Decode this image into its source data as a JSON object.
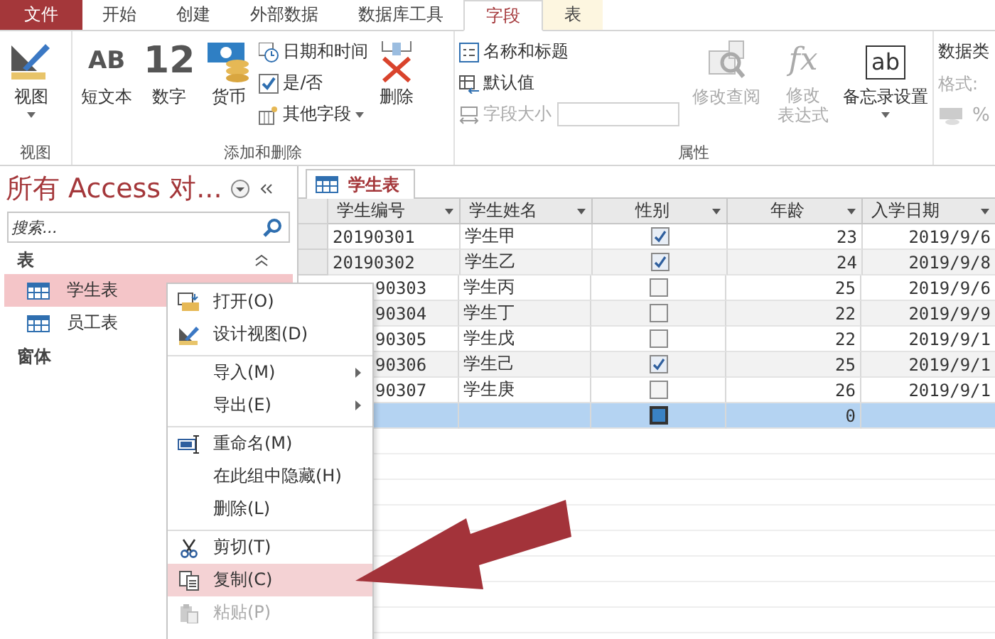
{
  "tabs": [
    {
      "label": "文件",
      "kind": "file",
      "selected": false
    },
    {
      "label": "开始",
      "kind": "normal",
      "selected": false
    },
    {
      "label": "创建",
      "kind": "normal",
      "selected": false
    },
    {
      "label": "外部数据",
      "kind": "normal",
      "selected": false
    },
    {
      "label": "数据库工具",
      "kind": "normal",
      "selected": false
    },
    {
      "label": "字段",
      "kind": "context",
      "selected": true
    },
    {
      "label": "表",
      "kind": "context",
      "selected": false
    }
  ],
  "ribbon": {
    "view": {
      "button": "视图",
      "group": "视图"
    },
    "add_delete": {
      "short_text": {
        "glyph": "AB",
        "label": "短文本"
      },
      "number": {
        "glyph": "12",
        "label": "数字"
      },
      "currency": "货币",
      "small": [
        "日期和时间",
        "是/否",
        "其他字段"
      ],
      "delete": "删除",
      "group": "添加和删除"
    },
    "properties": {
      "name_caption": "名称和标题",
      "default_value": "默认值",
      "field_size": {
        "label": "字段大小",
        "disabled": true
      },
      "modify_lookup": {
        "label": "修改查阅",
        "disabled": true
      },
      "modify_expression": {
        "glyph": "fx",
        "lines": [
          "修改",
          "表达式"
        ],
        "disabled": true
      },
      "memo": {
        "glyph": "ab",
        "label": "备忘录设置"
      },
      "group": "属性"
    },
    "data_type": {
      "title": "数据类",
      "format": {
        "label": "格式:",
        "disabled": true
      },
      "percent": "%"
    }
  },
  "nav": {
    "title": "所有 Access 对...",
    "search_placeholder": "搜索...",
    "groups": [
      {
        "label": "表",
        "expanded": true,
        "items": [
          {
            "label": "学生表",
            "selected": true
          },
          {
            "label": "员工表",
            "selected": false
          }
        ]
      },
      {
        "label": "窗体"
      }
    ]
  },
  "document_tab": "学生表",
  "table": {
    "columns": [
      "学生编号",
      "学生姓名",
      "性别",
      "年龄",
      "入学日期"
    ],
    "rows": [
      {
        "id": "20190301",
        "name": "学生甲",
        "gender": true,
        "age": "23",
        "date": "2019/9/6",
        "covered": false,
        "selected": false
      },
      {
        "id": "20190302",
        "name": "学生乙",
        "gender": true,
        "age": "24",
        "date": "2019/9/8",
        "covered": false,
        "selected": false
      },
      {
        "id": "90303",
        "name": "学生丙",
        "gender": false,
        "age": "25",
        "date": "2019/9/6",
        "covered": true,
        "selected": false
      },
      {
        "id": "90304",
        "name": "学生丁",
        "gender": false,
        "age": "22",
        "date": "2019/9/9",
        "covered": true,
        "selected": false
      },
      {
        "id": "90305",
        "name": "学生戊",
        "gender": false,
        "age": "22",
        "date": "2019/9/1",
        "covered": true,
        "selected": false
      },
      {
        "id": "90306",
        "name": "学生己",
        "gender": true,
        "age": "25",
        "date": "2019/9/1",
        "covered": true,
        "selected": false
      },
      {
        "id": "90307",
        "name": "学生庚",
        "gender": false,
        "age": "26",
        "date": "2019/9/1",
        "covered": true,
        "selected": false
      },
      {
        "age": "0",
        "covered": true,
        "selected": true
      }
    ]
  },
  "context_menu": [
    {
      "label": "打开(O)",
      "kind": "item",
      "separator_before": false,
      "selected": false,
      "disabled": false
    },
    {
      "label": "设计视图(D)",
      "kind": "item",
      "separator_before": false,
      "selected": false,
      "disabled": false
    },
    {
      "label": "导入(M)",
      "kind": "submenu",
      "separator_before": true,
      "selected": false,
      "disabled": false
    },
    {
      "label": "导出(E)",
      "kind": "submenu",
      "separator_before": false,
      "selected": false,
      "disabled": false
    },
    {
      "label": "重命名(M)",
      "kind": "item",
      "separator_before": true,
      "selected": false,
      "disabled": false
    },
    {
      "label": "在此组中隐藏(H)",
      "kind": "item",
      "separator_before": false,
      "selected": false,
      "disabled": false
    },
    {
      "label": "删除(L)",
      "kind": "item",
      "separator_before": false,
      "selected": false,
      "disabled": false
    },
    {
      "label": "剪切(T)",
      "kind": "item",
      "separator_before": true,
      "selected": false,
      "disabled": false
    },
    {
      "label": "复制(C)",
      "kind": "item",
      "separator_before": false,
      "selected": true,
      "disabled": false
    },
    {
      "label": "粘贴(P)",
      "kind": "item",
      "separator_before": false,
      "selected": false,
      "disabled": true
    }
  ]
}
